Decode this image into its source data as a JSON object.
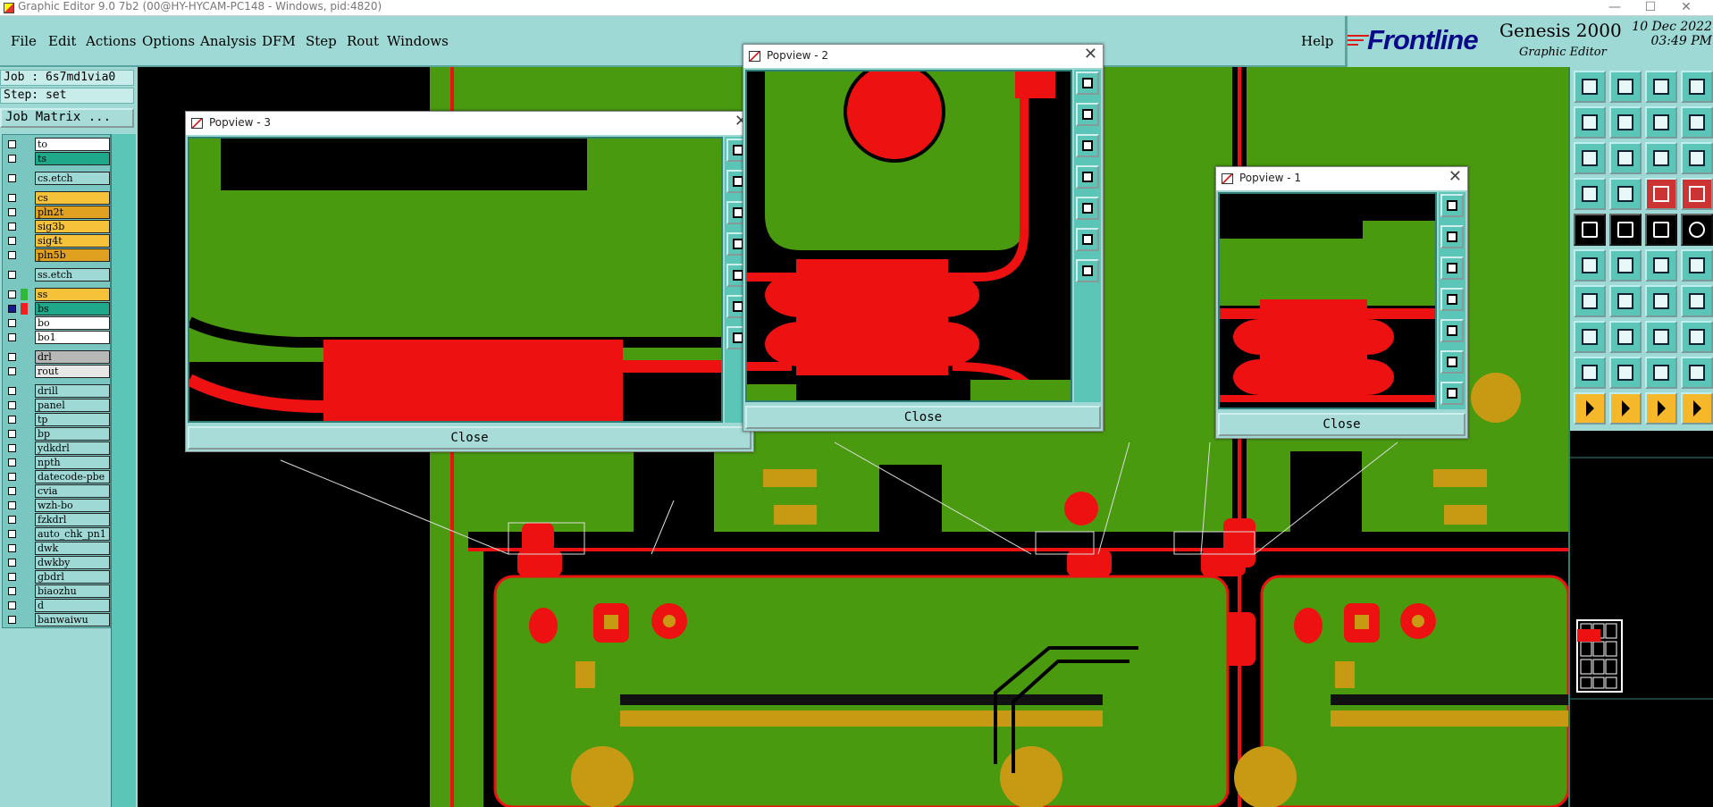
{
  "window": {
    "title": "Graphic Editor 9.0 7b2 (00@HY-HYCAM-PC148 - Windows, pid:4820)",
    "controls": [
      "—",
      "☐",
      "✕"
    ]
  },
  "menubar": {
    "items": [
      "File",
      "Edit",
      "Actions",
      "Options",
      "Analysis",
      "DFM",
      "Step",
      "Rout",
      "Windows"
    ],
    "help": "Help"
  },
  "brand": {
    "logo": "Frontline",
    "product": "Genesis 2000",
    "subtitle": "Graphic Editor",
    "date": "10 Dec 2022",
    "time": "03:49 PM"
  },
  "left_panel": {
    "job": "Job : 6s7md1via0",
    "step": "Step: set",
    "job_matrix_button": "Job Matrix ...",
    "layers": [
      {
        "name": "to",
        "color": "#ffffff",
        "swatch": ""
      },
      {
        "name": "ts",
        "color": "#1fa88a",
        "swatch": ""
      },
      {
        "name": "cs.etch",
        "color": "#9ed9d6",
        "swatch": ""
      },
      {
        "name": "cs",
        "color": "#f5c23a",
        "swatch": ""
      },
      {
        "name": "pln2t",
        "color": "#e0a020",
        "swatch": ""
      },
      {
        "name": "sig3b",
        "color": "#f5c23a",
        "swatch": ""
      },
      {
        "name": "sig4t",
        "color": "#f5c23a",
        "swatch": ""
      },
      {
        "name": "pln5b",
        "color": "#e0a020",
        "swatch": ""
      },
      {
        "name": "ss.etch",
        "color": "#9ed9d6",
        "swatch": ""
      },
      {
        "name": "ss",
        "color": "#f5c23a",
        "swatch": "#2fb83a"
      },
      {
        "name": "bs",
        "color": "#1fa88a",
        "swatch": "#ee2020"
      },
      {
        "name": "bo",
        "color": "#ffffff",
        "swatch": ""
      },
      {
        "name": "bo1",
        "color": "#ffffff",
        "swatch": ""
      },
      {
        "name": "drl",
        "color": "#b8b8b8",
        "swatch": ""
      },
      {
        "name": "rout",
        "color": "#e8e8e8",
        "swatch": ""
      },
      {
        "name": "drill",
        "color": "#9ed9d6",
        "swatch": ""
      },
      {
        "name": "panel",
        "color": "#9ed9d6",
        "swatch": ""
      },
      {
        "name": "tp",
        "color": "#9ed9d6",
        "swatch": ""
      },
      {
        "name": "bp",
        "color": "#9ed9d6",
        "swatch": ""
      },
      {
        "name": "ydkdrl",
        "color": "#9ed9d6",
        "swatch": ""
      },
      {
        "name": "npth",
        "color": "#9ed9d6",
        "swatch": ""
      },
      {
        "name": "datecode-pbe",
        "color": "#9ed9d6",
        "swatch": ""
      },
      {
        "name": "cvia",
        "color": "#9ed9d6",
        "swatch": ""
      },
      {
        "name": "wzh-bo",
        "color": "#9ed9d6",
        "swatch": ""
      },
      {
        "name": "fzkdrl",
        "color": "#9ed9d6",
        "swatch": ""
      },
      {
        "name": "auto_chk_pn1",
        "color": "#9ed9d6",
        "swatch": ""
      },
      {
        "name": "dwk",
        "color": "#9ed9d6",
        "swatch": ""
      },
      {
        "name": "dwkby",
        "color": "#9ed9d6",
        "swatch": ""
      },
      {
        "name": "gbdrl",
        "color": "#9ed9d6",
        "swatch": ""
      },
      {
        "name": "biaozhu",
        "color": "#9ed9d6",
        "swatch": ""
      },
      {
        "name": "d",
        "color": "#9ed9d6",
        "swatch": ""
      },
      {
        "name": "banwaiwu",
        "color": "#9ed9d6",
        "swatch": ""
      }
    ]
  },
  "popviews": [
    {
      "id": "popview-3",
      "title": "Popview - 3",
      "close_label": "Close"
    },
    {
      "id": "popview-2",
      "title": "Popview - 2",
      "close_label": "Close"
    },
    {
      "id": "popview-1",
      "title": "Popview - 1",
      "close_label": "Close"
    }
  ],
  "toolbar": {
    "rows": [
      [
        "zoom-home-icon",
        "zoom-in-icon",
        "home-icon",
        "grid-icon"
      ],
      [
        "pan-left-icon",
        "pan-right-icon",
        "zoom-back-icon",
        "redraw-icon"
      ],
      [
        "zoom-fit-icon",
        "zoom-center-icon",
        "one-to-one-icon",
        "query-icon"
      ],
      [
        "measure-icon",
        "snap-grid-icon",
        "layer-red-icon",
        "layer-red2-icon"
      ],
      [
        "pad-add-icon",
        "line-add-icon",
        "ruler-icon",
        "circle-icon"
      ],
      [
        "node-link-icon",
        "cross-node-icon",
        "line-join-icon",
        "line-split-icon"
      ],
      [
        "angle-line-icon",
        "slash-line-icon",
        "arc-icon",
        "text-f-icon"
      ],
      [
        "shape-edit-icon",
        "line-break-icon",
        "resize-icon",
        "copy-shape-icon"
      ],
      [
        "triangle-a-icon",
        "triangle-b-icon",
        "triangle-c-icon",
        "triangle-d-icon"
      ],
      [
        "select-pointer-icon",
        "select-pointer2-icon",
        "select-pointer3-icon",
        "select-move-icon"
      ]
    ]
  }
}
